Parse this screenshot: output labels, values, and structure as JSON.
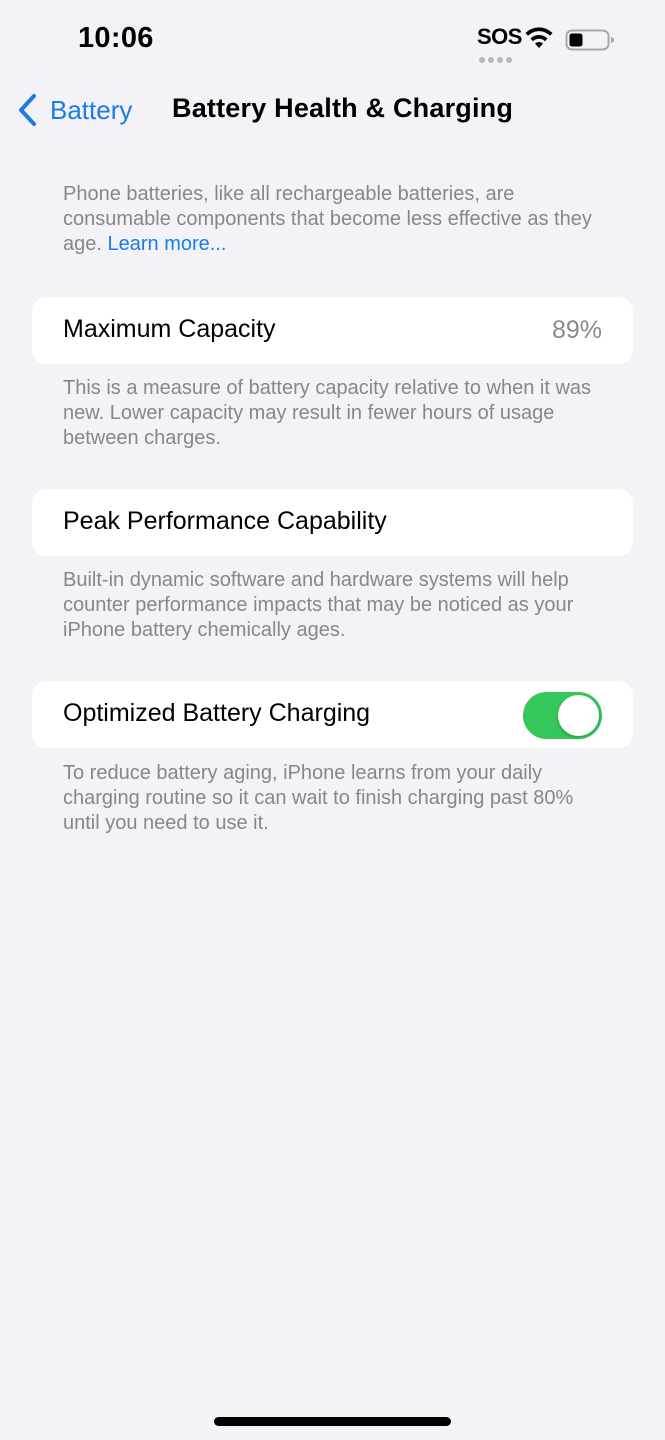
{
  "status_bar": {
    "time": "10:06",
    "sos": "SOS",
    "icons": [
      "wifi-icon",
      "battery-icon"
    ]
  },
  "nav": {
    "back_label": "Battery",
    "title": "Battery Health & Charging",
    "back_icon": "chevron-left-icon"
  },
  "intro": {
    "text": "Phone batteries, like all rechargeable batteries, are consumable components that become less effective as they age.",
    "link": "Learn more..."
  },
  "maximum_capacity": {
    "label": "Maximum Capacity",
    "value": "89%",
    "footnote": "This is a measure of battery capacity relative to when it was new. Lower capacity may result in fewer hours of usage between charges."
  },
  "peak_performance": {
    "label": "Peak Performance Capability",
    "footnote": "Built-in dynamic software and hardware systems will help counter performance impacts that may be noticed as your iPhone battery chemically ages."
  },
  "optimized_charging": {
    "label": "Optimized Battery Charging",
    "enabled": true,
    "footnote": "To reduce battery aging, iPhone learns from your daily charging routine so it can wait to finish charging past 80% until you need to use it."
  },
  "colors": {
    "accent": "#1b7ce4",
    "toggle_on": "#34c759",
    "background": "#f2f2f7",
    "secondary_text": "#86868b"
  }
}
